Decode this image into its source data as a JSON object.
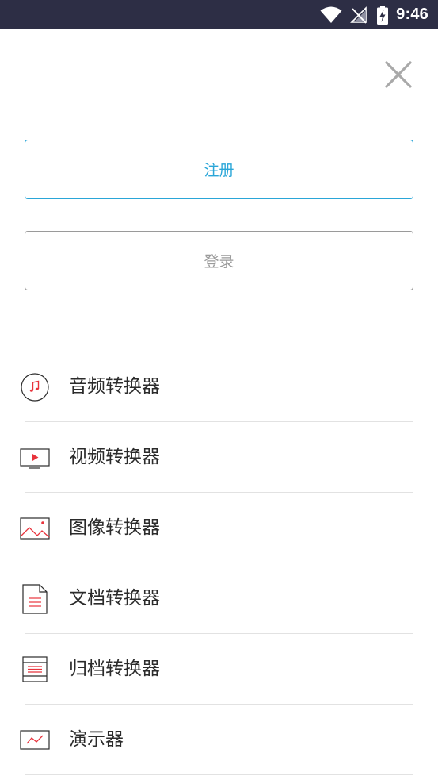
{
  "status_bar": {
    "time": "9:46",
    "icons": [
      "wifi-icon",
      "signal-off-icon",
      "battery-charging-icon"
    ]
  },
  "close": {
    "icon": "close-icon"
  },
  "buttons": {
    "register_label": "注册",
    "login_label": "登录",
    "register_color": "#2aa6d8",
    "login_color": "#9a9a9a"
  },
  "menu": {
    "accent_color": "#e8333c",
    "items": [
      {
        "label": "音频转换器",
        "icon": "music-note-icon"
      },
      {
        "label": "视频转换器",
        "icon": "video-play-icon"
      },
      {
        "label": "图像转换器",
        "icon": "image-icon"
      },
      {
        "label": "文档转换器",
        "icon": "document-icon"
      },
      {
        "label": "归档转换器",
        "icon": "archive-icon"
      },
      {
        "label": "演示器",
        "icon": "presentation-icon"
      }
    ]
  }
}
